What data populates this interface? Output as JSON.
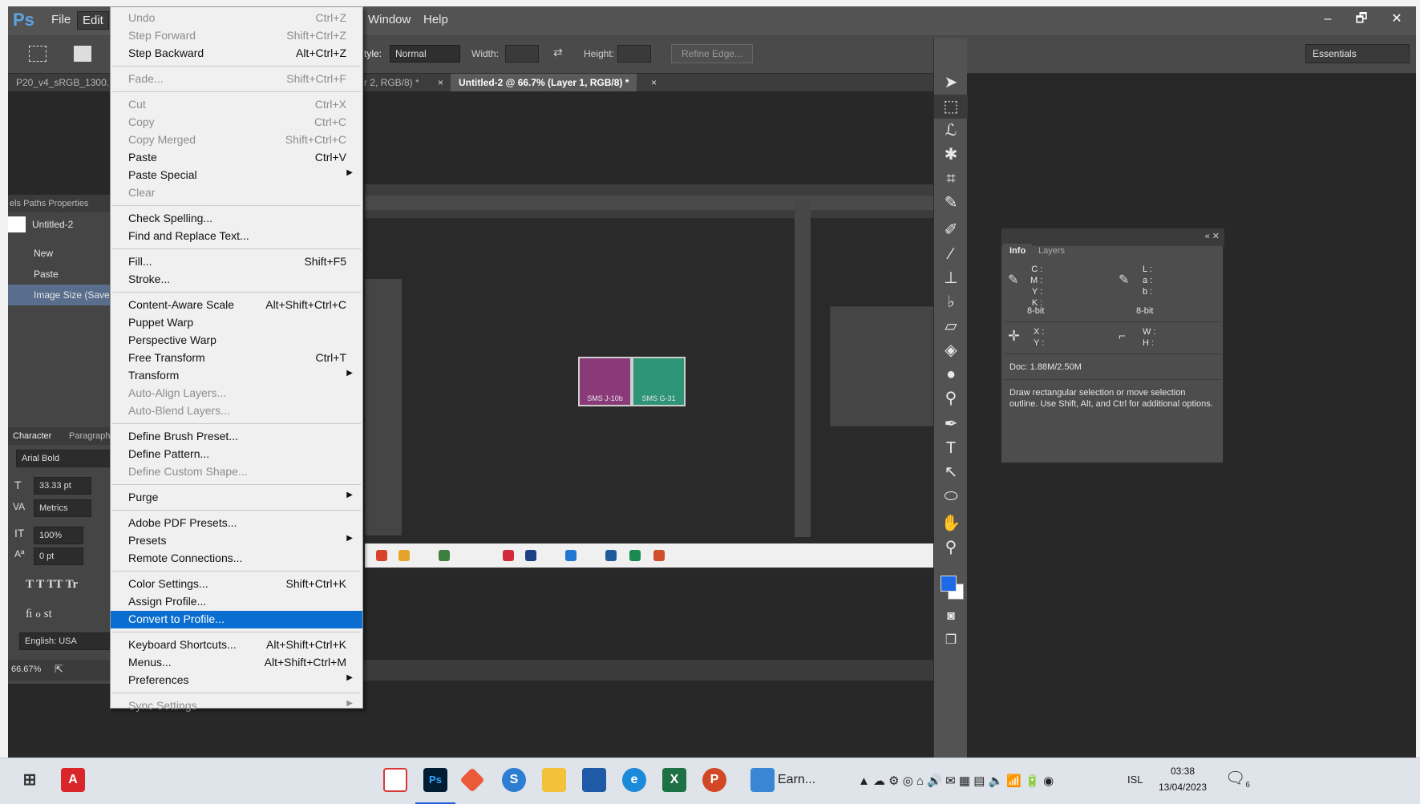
{
  "app": {
    "logo": "Ps",
    "menu": [
      "File",
      "Edit",
      "Window",
      "Help"
    ],
    "window_controls": [
      "–",
      "🗗",
      "✕"
    ]
  },
  "options_bar": {
    "style_label": "tyle:",
    "style_value": "Normal",
    "width_label": "Width:",
    "height_label": "Height:",
    "refine_edge": "Refine Edge...",
    "workspace": "Essentials"
  },
  "tabs": {
    "left": "P20_v4_sRGB_1300.",
    "middle": "r 2, RGB/8) *",
    "active": "Untitled-2 @ 66.7% (Layer 1, RGB/8) *",
    "close": "×"
  },
  "left_panel": {
    "tabs": "els  Paths  Properties",
    "history_title": "Untitled-2",
    "history": [
      "New",
      "Paste",
      "Image Size (Save As"
    ],
    "char_tabs": [
      "Character",
      "Paragraph"
    ],
    "font": "Arial Bold",
    "size": "33.33 pt",
    "kerning": "Metrics",
    "scale": "100%",
    "baseline": "0 pt",
    "styles": "T  T  TT  Tr",
    "language": "English: USA"
  },
  "status": {
    "zoom": "66.67%"
  },
  "canvas": {
    "swatch1": {
      "label": "SMS J-10b",
      "color": "#8a3a78"
    },
    "swatch2": {
      "label": "SMS G-31",
      "color": "#2e9477"
    }
  },
  "info_panel": {
    "tabs": [
      "Info",
      "Layers"
    ],
    "cmyk": "C :\nM :\nY :\nK :",
    "bit1": "8-bit",
    "lab": "L :\na :\nb :",
    "bit2": "8-bit",
    "xy": "X :\nY :",
    "wh": "W :\nH :",
    "doc": "Doc: 1.88M/2.50M",
    "hint": "Draw rectangular selection or move selection outline.  Use Shift, Alt, and Ctrl for additional options."
  },
  "edit_menu": [
    {
      "label": "Undo",
      "shortcut": "Ctrl+Z",
      "disabled": true
    },
    {
      "label": "Step Forward",
      "shortcut": "Shift+Ctrl+Z",
      "disabled": true
    },
    {
      "label": "Step Backward",
      "shortcut": "Alt+Ctrl+Z"
    },
    {
      "label": "Fade...",
      "shortcut": "Shift+Ctrl+F",
      "disabled": true
    },
    {
      "label": "Cut",
      "shortcut": "Ctrl+X",
      "disabled": true
    },
    {
      "label": "Copy",
      "shortcut": "Ctrl+C",
      "disabled": true
    },
    {
      "label": "Copy Merged",
      "shortcut": "Shift+Ctrl+C",
      "disabled": true
    },
    {
      "label": "Paste",
      "shortcut": "Ctrl+V"
    },
    {
      "label": "Paste Special",
      "submenu": true
    },
    {
      "label": "Clear",
      "disabled": true
    },
    {
      "label": "Check Spelling..."
    },
    {
      "label": "Find and Replace Text..."
    },
    {
      "label": "Fill...",
      "shortcut": "Shift+F5"
    },
    {
      "label": "Stroke..."
    },
    {
      "label": "Content-Aware Scale",
      "shortcut": "Alt+Shift+Ctrl+C"
    },
    {
      "label": "Puppet Warp"
    },
    {
      "label": "Perspective Warp"
    },
    {
      "label": "Free Transform",
      "shortcut": "Ctrl+T"
    },
    {
      "label": "Transform",
      "submenu": true
    },
    {
      "label": "Auto-Align Layers...",
      "disabled": true
    },
    {
      "label": "Auto-Blend Layers...",
      "disabled": true
    },
    {
      "label": "Define Brush Preset..."
    },
    {
      "label": "Define Pattern..."
    },
    {
      "label": "Define Custom Shape...",
      "disabled": true
    },
    {
      "label": "Purge",
      "submenu": true
    },
    {
      "label": "Adobe PDF Presets..."
    },
    {
      "label": "Presets",
      "submenu": true
    },
    {
      "label": "Remote Connections..."
    },
    {
      "label": "Color Settings...",
      "shortcut": "Shift+Ctrl+K"
    },
    {
      "label": "Assign Profile..."
    },
    {
      "label": "Convert to Profile...",
      "highlighted": true
    },
    {
      "label": "Keyboard Shortcuts...",
      "shortcut": "Alt+Shift+Ctrl+K"
    },
    {
      "label": "Menus...",
      "shortcut": "Alt+Shift+Ctrl+M"
    },
    {
      "label": "Preferences",
      "submenu": true
    },
    {
      "label": "Sync Settings",
      "submenu": true,
      "disabled": true
    }
  ],
  "taskbar": {
    "earn": "Earn...",
    "lang": "ISL",
    "time": "03:38",
    "date": "13/04/2023",
    "notif": "6"
  }
}
